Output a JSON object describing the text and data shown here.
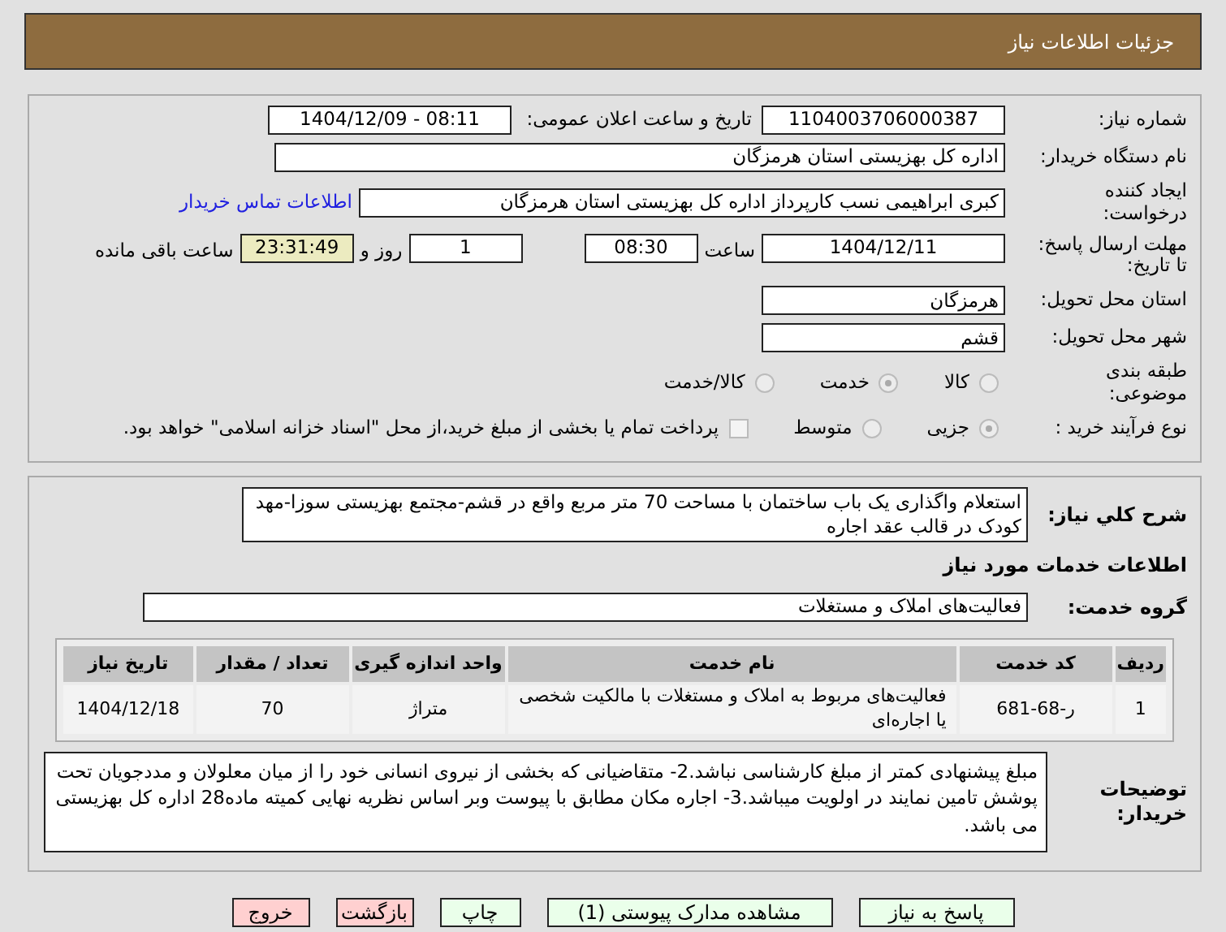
{
  "header": {
    "title": "جزئیات اطلاعات نیاز"
  },
  "need_number": {
    "label": "شماره نیاز:",
    "value": "1104003706000387"
  },
  "announce": {
    "label": "تاریخ و ساعت اعلان عمومی:",
    "value": "1404/12/09 - 08:11"
  },
  "buyer": {
    "label": "نام دستگاه خریدار:",
    "value": "اداره کل بهزیستی استان هرمزگان"
  },
  "requester": {
    "label": "ایجاد کننده درخواست:",
    "value": "کبری  ابراهیمی نسب کارپرداز اداره کل بهزیستی استان هرمزگان",
    "link": "اطلاعات تماس خریدار"
  },
  "deadline": {
    "label": "مهلت ارسال پاسخ: تا تاریخ:",
    "date": "1404/12/11",
    "time_label": "ساعت",
    "time": "08:30",
    "days": "1",
    "days_label": "روز و",
    "remaining": "23:31:49",
    "remaining_label": "ساعت باقی مانده"
  },
  "province": {
    "label": "استان محل تحویل:",
    "value": "هرمزگان"
  },
  "city": {
    "label": "شهر محل تحویل:",
    "value": "قشم"
  },
  "category": {
    "label": "طبقه بندی موضوعی:",
    "options": [
      {
        "label": "کالا",
        "selected": false
      },
      {
        "label": "خدمت",
        "selected": true
      },
      {
        "label": "کالا/خدمت",
        "selected": false
      }
    ]
  },
  "process": {
    "label": "نوع فرآیند خرید :",
    "options": [
      {
        "label": "جزیی",
        "selected": true
      },
      {
        "label": "متوسط",
        "selected": false
      }
    ],
    "payment": {
      "checked": false,
      "text": "پرداخت تمام یا بخشی از مبلغ خرید،از محل \"اسناد خزانه اسلامی\" خواهد بود."
    }
  },
  "summary": {
    "label": "شرح کلي نیاز:",
    "value": "استعلام واگذاری یک باب ساختمان با مساحت 70 متر مربع واقع در قشم-مجتمع بهزیستی سوزا-مهد کودک در قالب عقد اجاره"
  },
  "services_heading": "اطلاعات خدمات مورد نیاز",
  "service_group": {
    "label": "گروه خدمت:",
    "value": "فعالیت‌های  املاک و مستغلات"
  },
  "table": {
    "columns": [
      "ردیف",
      "کد خدمت",
      "نام خدمت",
      "واحد اندازه گیری",
      "تعداد / مقدار",
      "تاریخ نیاز"
    ],
    "rows": [
      [
        "1",
        "ر-68-681",
        "فعالیت‌های مربوط به املاک و مستغلات با مالکیت شخصی یا اجاره‌ای",
        "متراژ",
        "70",
        "1404/12/18"
      ]
    ]
  },
  "notes": {
    "label": "توضیحات خریدار:",
    "value": "مبلغ پیشنهادی کمتر از مبلغ کارشناسی نباشد.2- متقاضیانی که بخشی از نیروی انسانی خود را از میان معلولان و مددجویان تحت پوشش تامین نمایند در اولویت میباشد.3-  اجاره مکان  مطابق با پیوست وبر اساس نظریه نهایی کمیته ماده28 اداره کل بهزیستی می باشد."
  },
  "buttons": [
    {
      "label": "پاسخ به نیاز",
      "kind": "primary"
    },
    {
      "label": "مشاهده مدارک پیوستی (1)",
      "kind": "primary"
    },
    {
      "label": "چاپ",
      "kind": "primary"
    },
    {
      "label": "بازگشت",
      "kind": "danger"
    },
    {
      "label": "خروج",
      "kind": "danger"
    }
  ]
}
